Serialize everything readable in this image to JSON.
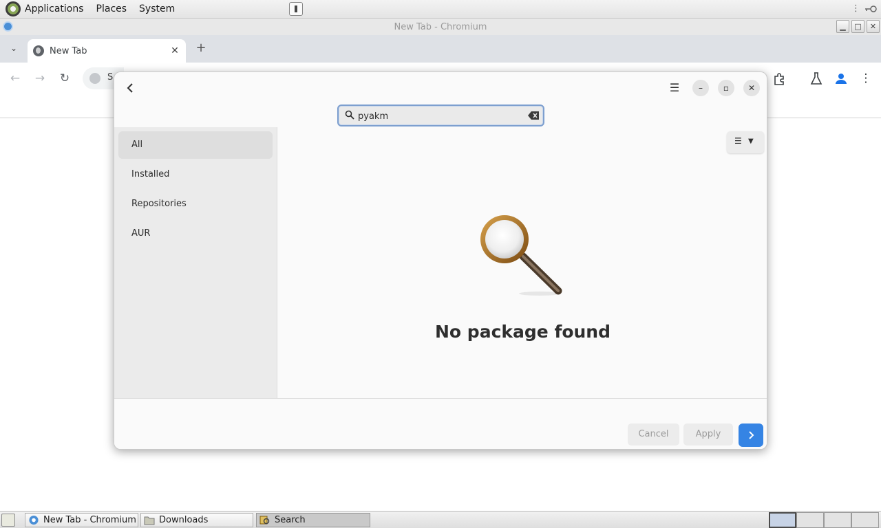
{
  "top_panel": {
    "menus": [
      "Applications",
      "Places",
      "System"
    ]
  },
  "browser": {
    "window_title": "New Tab - Chromium",
    "tab_title": "New Tab",
    "omnibox_partial_text": "S"
  },
  "dialog": {
    "search_value": "pyakm",
    "sidebar_items": [
      "All",
      "Installed",
      "Repositories",
      "AUR"
    ],
    "empty_message": "No package found",
    "cancel_label": "Cancel",
    "apply_label": "Apply"
  },
  "taskbar": {
    "items": [
      "New Tab - Chromium",
      "Downloads",
      "Search"
    ]
  },
  "colors": {
    "accent": "#3584e4",
    "panel": "#e8e8e8",
    "dialog_bg": "#fafafa"
  }
}
